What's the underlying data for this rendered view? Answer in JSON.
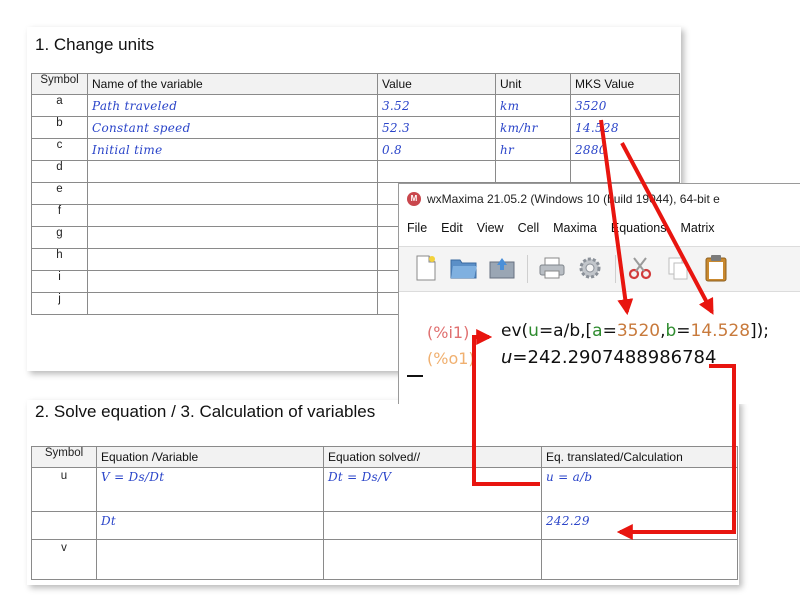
{
  "section1": {
    "title": "1. Change units",
    "headers": [
      "Symbol",
      "Name of the variable",
      "Value",
      "Unit",
      "MKS Value"
    ],
    "rows": [
      {
        "symbol": "a",
        "name": "Path traveled",
        "value": "3.52",
        "unit": "km",
        "mks": "3520"
      },
      {
        "symbol": "b",
        "name": "Constant speed",
        "value": "52.3",
        "unit": "km/hr",
        "mks": "14.528"
      },
      {
        "symbol": "c",
        "name": "Initial time",
        "value": "0.8",
        "unit": "hr",
        "mks": "2880"
      },
      {
        "symbol": "d",
        "name": "",
        "value": "",
        "unit": "",
        "mks": ""
      },
      {
        "symbol": "e",
        "name": "",
        "value": "",
        "unit": "",
        "mks": ""
      },
      {
        "symbol": "f",
        "name": "",
        "value": "",
        "unit": "",
        "mks": ""
      },
      {
        "symbol": "g",
        "name": "",
        "value": "",
        "unit": "",
        "mks": ""
      },
      {
        "symbol": "h",
        "name": "",
        "value": "",
        "unit": "",
        "mks": ""
      },
      {
        "symbol": "i",
        "name": "",
        "value": "",
        "unit": "",
        "mks": ""
      },
      {
        "symbol": "j",
        "name": "",
        "value": "",
        "unit": "",
        "mks": ""
      }
    ]
  },
  "section2": {
    "title": "2. Solve equation / 3. Calculation of variables",
    "headers": [
      "Symbol",
      "Equation /Variable",
      "Equation solved//",
      "Eq. translated/Calculation"
    ],
    "rows": [
      {
        "symbol": "u",
        "equation": "V = Ds/Dt",
        "solved": "Dt = Ds/V",
        "translated": "u = a/b"
      },
      {
        "symbol": "",
        "equation": "Dt",
        "solved": "",
        "translated": "242.29"
      },
      {
        "symbol": "v",
        "equation": "",
        "solved": "",
        "translated": ""
      }
    ]
  },
  "wxmaxima": {
    "title": "wxMaxima 21.05.2 (Windows 10 (build 19044), 64-bit e",
    "logo_text": "M",
    "menu": [
      "File",
      "Edit",
      "View",
      "Cell",
      "Maxima",
      "Equations",
      "Matrix"
    ],
    "toolbar_icons": [
      "new-document-icon",
      "open-folder-icon",
      "save-icon",
      "print-icon",
      "settings-gear-icon",
      "cut-scissors-icon",
      "copy-icon",
      "paste-clipboard-icon"
    ],
    "input_label": "(%i1)",
    "input_parts": {
      "fn": "ev(",
      "u": "u",
      "eq1": "=a/b,[",
      "a": "a",
      "eq2": "=",
      "n1": "3520",
      "comma": ",",
      "b": "b",
      "eq3": "=",
      "n2": "14.528",
      "end": "]);"
    },
    "output_label": "(%o1)",
    "output_var": "u",
    "output_value": "=242.2907488986784"
  },
  "colors": {
    "handwriting": "#2b45c9",
    "arrow": "#e8150f",
    "input_label": "#e07070",
    "output_label": "#f0b070",
    "maxima_var": "#2e8b2e",
    "maxima_num": "#c87a3c"
  }
}
